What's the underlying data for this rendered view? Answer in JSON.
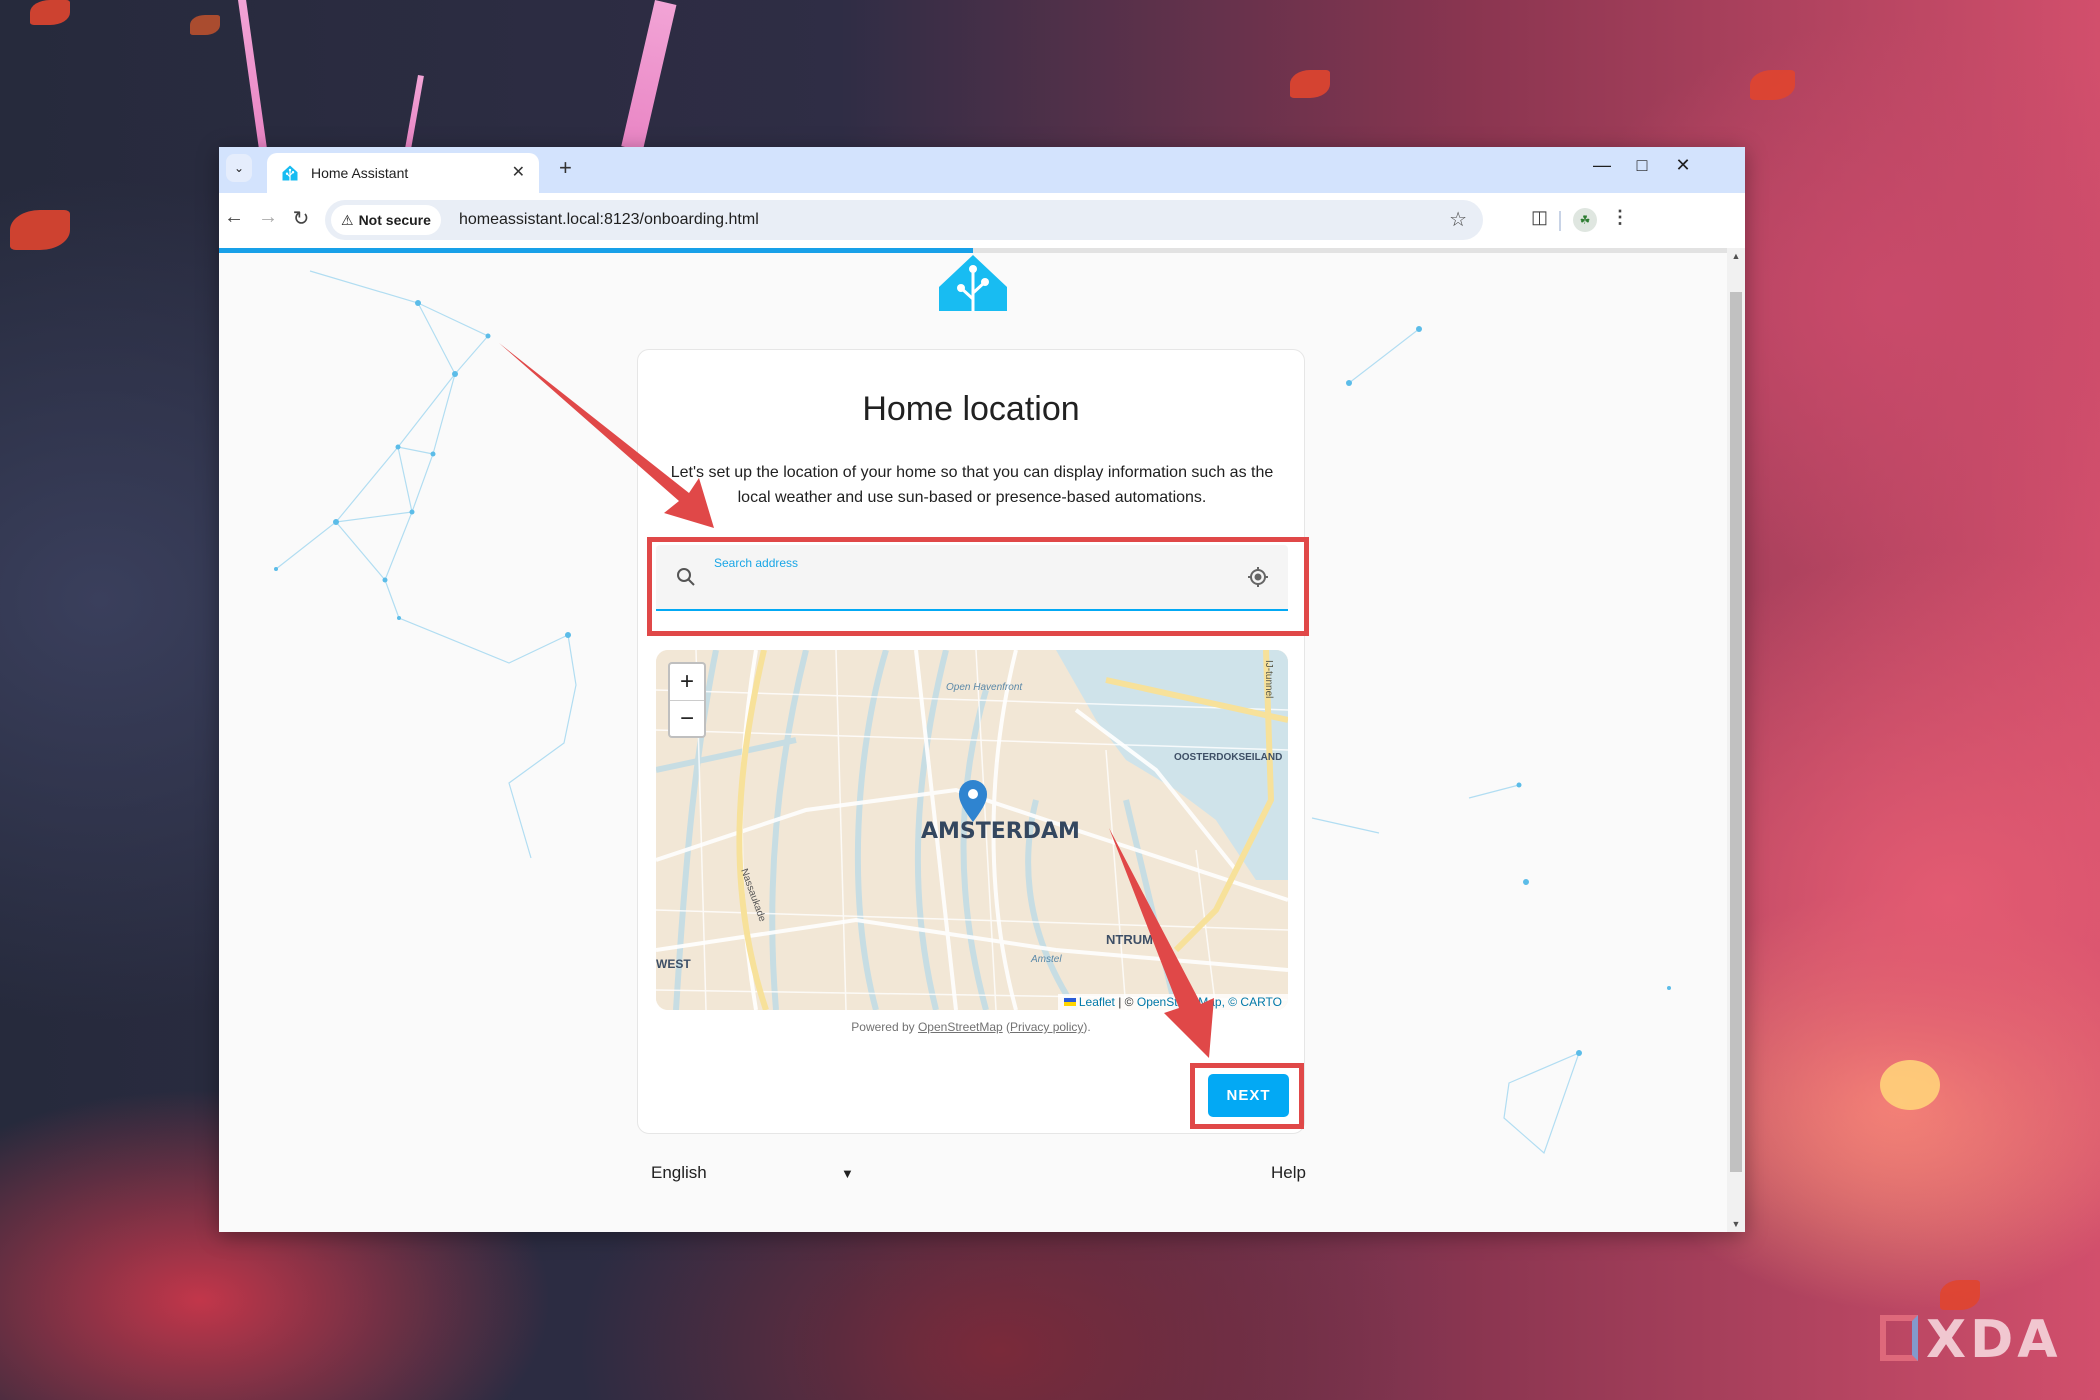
{
  "browser": {
    "tab_title": "Home Assistant",
    "new_tab_label": "+",
    "security_label": "Not secure",
    "url": "homeassistant.local:8123/onboarding.html",
    "page_load_progress": 0.5
  },
  "onboarding": {
    "title": "Home location",
    "description": "Let's set up the location of your home so that you can display information such as the local weather and use sun-based or presence-based automations.",
    "search": {
      "label": "Search address",
      "value": ""
    },
    "map": {
      "zoom_in_label": "+",
      "zoom_out_label": "−",
      "marker_city": "AMSTERDAM",
      "labels": [
        "Open Havenfront",
        "OOSTERDOKSEILAND",
        "IJ-tunnel",
        "Nassaukade",
        "WEST",
        "NTRUM",
        "Amstel"
      ],
      "attribution": {
        "leaflet": "Leaflet",
        "separator": " | © ",
        "osm": "OpenStreetMap",
        "carto": ", © CARTO"
      }
    },
    "powered_by": {
      "prefix": "Powered by ",
      "osm_link": "OpenStreetMap",
      "open_paren": " (",
      "privacy_link": "Privacy policy",
      "close": ")."
    },
    "next_label": "NEXT"
  },
  "footer": {
    "language": "English",
    "help": "Help"
  },
  "watermark": "XDA",
  "colors": {
    "accent": "#03a9f4",
    "annotation_red": "#e04848"
  }
}
